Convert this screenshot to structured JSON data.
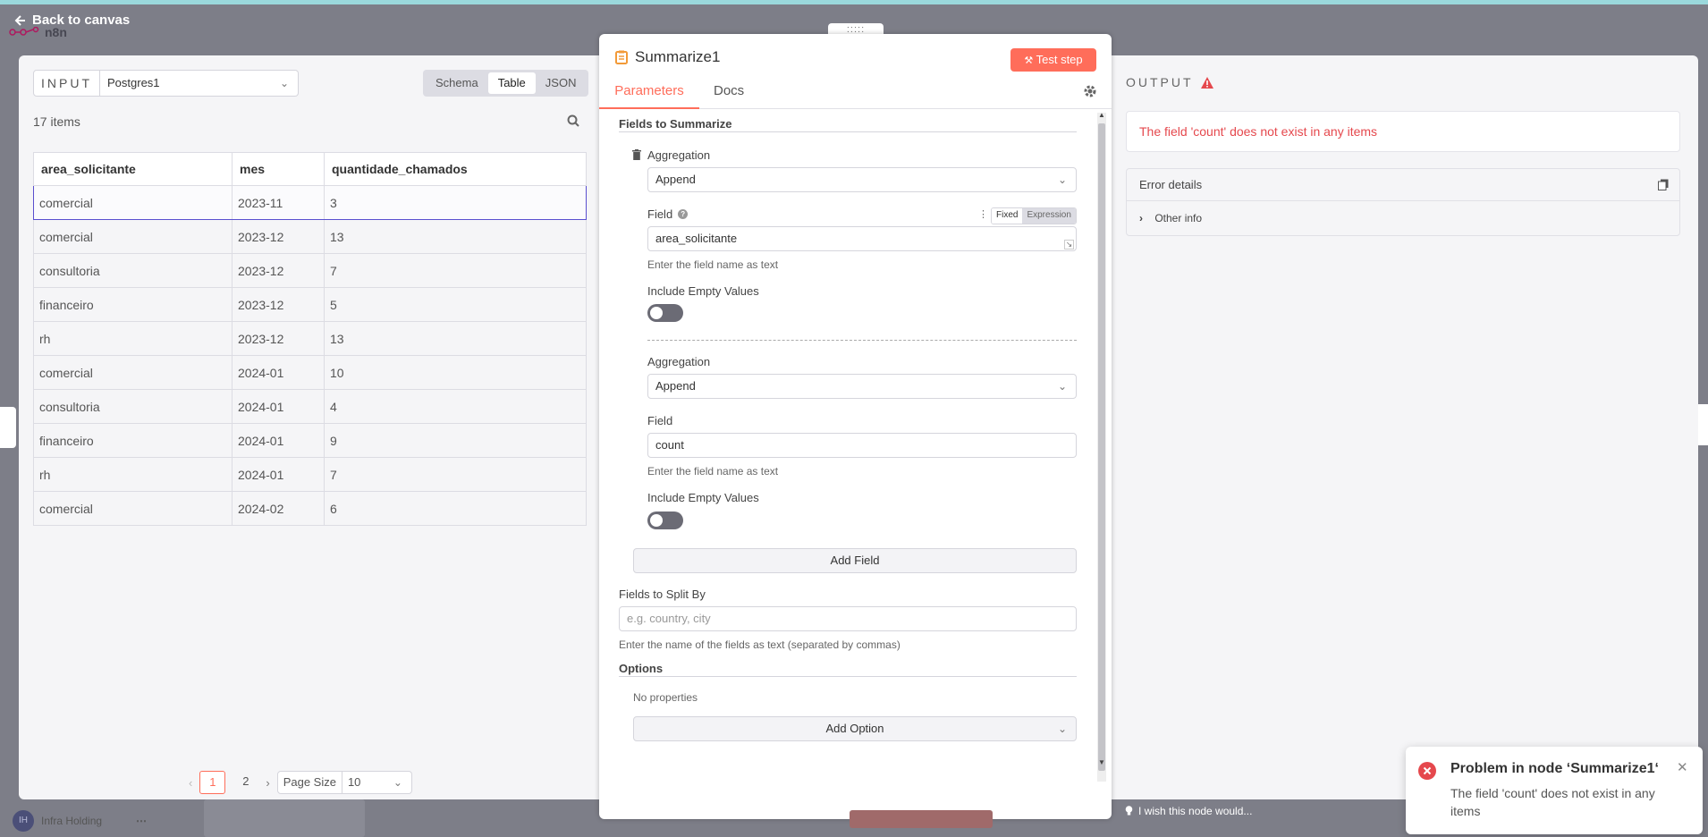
{
  "header": {
    "back_label": "Back to canvas",
    "logo_text": "n8n"
  },
  "input_panel": {
    "label": "INPUT",
    "node_select": "Postgres1",
    "views": [
      "Schema",
      "Table",
      "JSON"
    ],
    "active_view": "Table",
    "item_count": "17 items",
    "columns": [
      "area_solicitante",
      "mes",
      "quantidade_chamados"
    ],
    "rows": [
      [
        "comercial",
        "2023-11",
        "3"
      ],
      [
        "comercial",
        "2023-12",
        "13"
      ],
      [
        "consultoria",
        "2023-12",
        "7"
      ],
      [
        "financeiro",
        "2023-12",
        "5"
      ],
      [
        "rh",
        "2023-12",
        "13"
      ],
      [
        "comercial",
        "2024-01",
        "10"
      ],
      [
        "consultoria",
        "2024-01",
        "4"
      ],
      [
        "financeiro",
        "2024-01",
        "9"
      ],
      [
        "rh",
        "2024-01",
        "7"
      ],
      [
        "comercial",
        "2024-02",
        "6"
      ]
    ],
    "pagination": {
      "pages": [
        "1",
        "2"
      ],
      "current": "1",
      "page_size_label": "Page Size",
      "page_size": "10"
    }
  },
  "node_panel": {
    "title": "Summarize1",
    "test_label": "Test step",
    "tabs": [
      "Parameters",
      "Docs"
    ],
    "fields_to_summarize_label": "Fields to Summarize",
    "aggregations": [
      {
        "aggregation_label": "Aggregation",
        "aggregation_value": "Append",
        "field_label": "Field",
        "field_value": "area_solicitante",
        "field_hint": "Enter the field name as text",
        "include_empty_label": "Include Empty Values",
        "mode_fixed": "Fixed",
        "mode_expression": "Expression"
      },
      {
        "aggregation_label": "Aggregation",
        "aggregation_value": "Append",
        "field_label": "Field",
        "field_value": "count",
        "field_hint": "Enter the field name as text",
        "include_empty_label": "Include Empty Values"
      }
    ],
    "add_field_label": "Add Field",
    "split_by_label": "Fields to Split By",
    "split_by_placeholder": "e.g. country, city",
    "split_by_hint": "Enter the name of the fields as text (separated by commas)",
    "options_label": "Options",
    "no_properties": "No properties",
    "add_option_label": "Add Option"
  },
  "output_panel": {
    "label": "OUTPUT",
    "error_message": "The field 'count' does not exist in any items",
    "error_details_label": "Error details",
    "other_info_label": "Other info"
  },
  "toast": {
    "title": "Problem in node ‘Summarize1‘",
    "message": "The field 'count' does not exist in any items"
  },
  "footer": {
    "wish_label": "I wish this node would...",
    "user_initials": "IH",
    "user_name": "Infra Holding"
  },
  "colors": {
    "accent": "#ff6d5a",
    "error": "#e5484d",
    "selection": "#5a4fcf"
  }
}
